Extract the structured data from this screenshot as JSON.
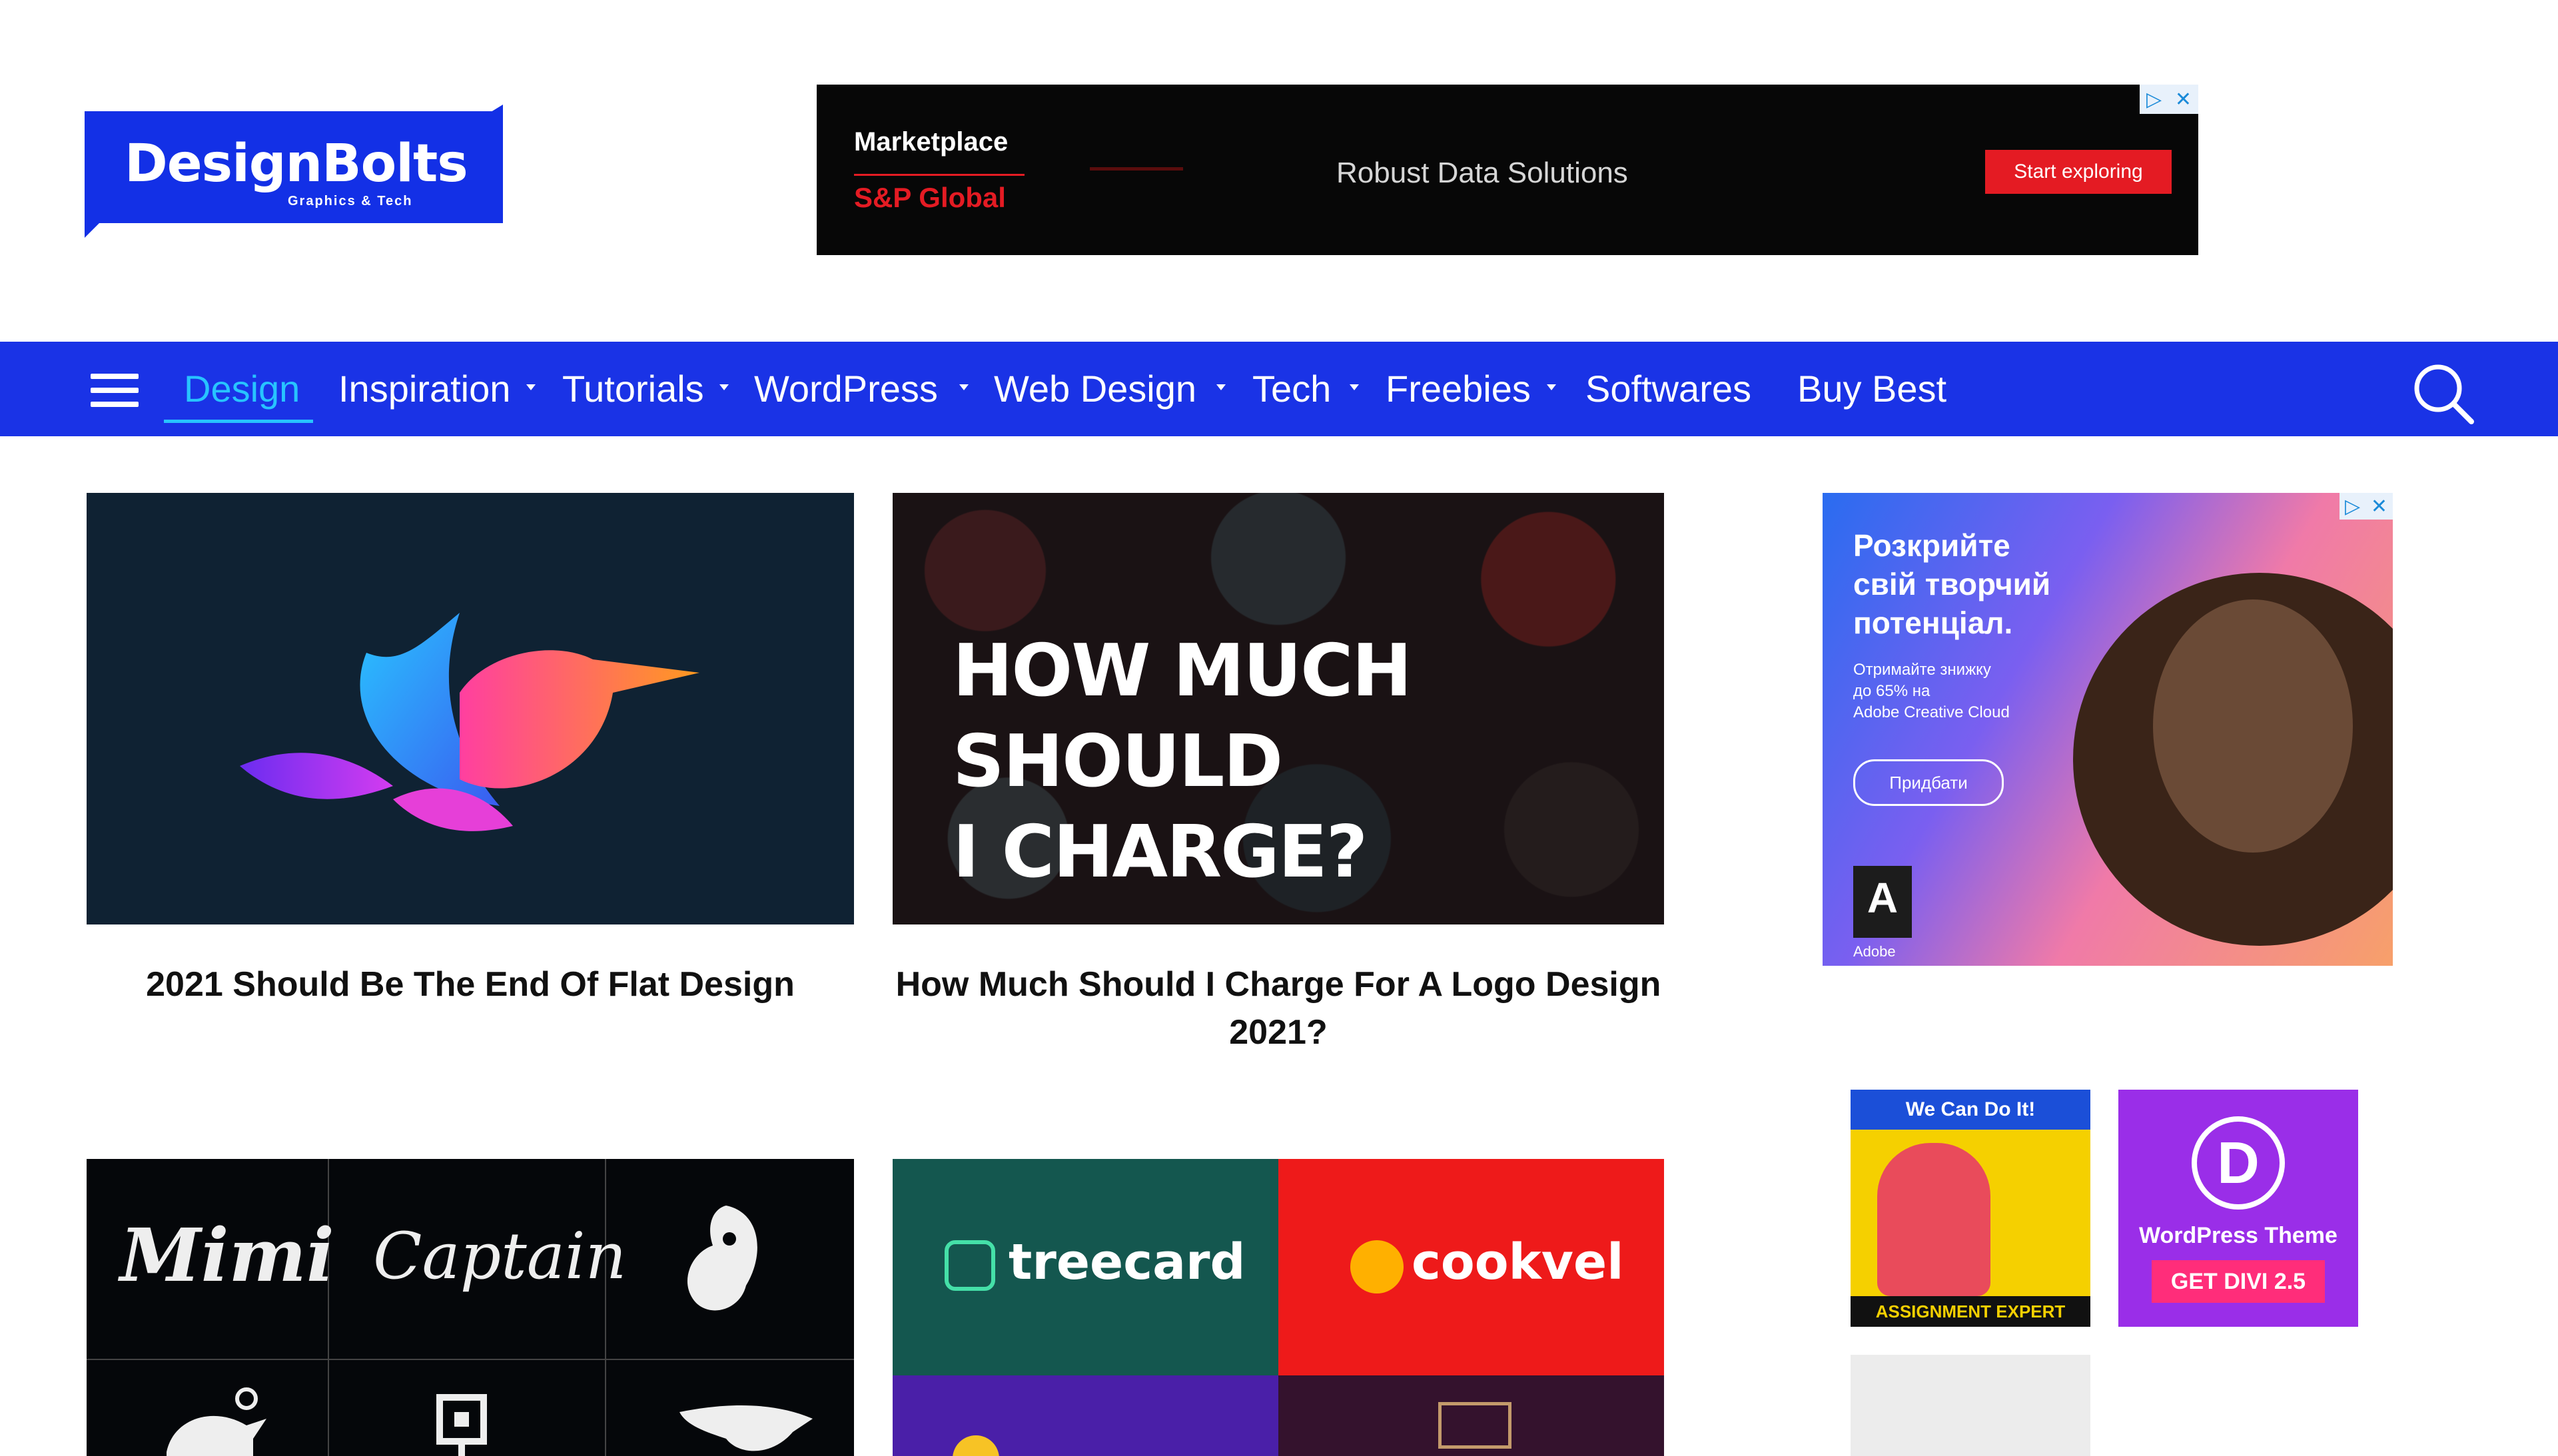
{
  "logo": {
    "text": "DesignBolts",
    "subtext": "Graphics & Tech"
  },
  "top_ad": {
    "brand_line1": "Marketplace",
    "brand_line2": "S&P Global",
    "tagline": "Robust Data Solutions",
    "cta": "Start exploring"
  },
  "nav": {
    "items": [
      {
        "label": "Design",
        "has_dropdown": false,
        "active": true
      },
      {
        "label": "Inspiration",
        "has_dropdown": true
      },
      {
        "label": "Tutorials",
        "has_dropdown": true
      },
      {
        "label": "WordPress",
        "has_dropdown": true
      },
      {
        "label": "Web Design",
        "has_dropdown": true
      },
      {
        "label": "Tech",
        "has_dropdown": true
      },
      {
        "label": "Freebies",
        "has_dropdown": true
      },
      {
        "label": "Softwares",
        "has_dropdown": false
      },
      {
        "label": "Buy Best",
        "has_dropdown": false
      }
    ]
  },
  "articles": [
    {
      "title": "2021 Should Be The End Of Flat Design"
    },
    {
      "title": "How Much Should I Charge For A Logo Design 2021?",
      "image_text_line1": "HOW MUCH SHOULD",
      "image_text_line2": "I CHARGE?"
    }
  ],
  "logos_grid": {
    "sig1": "Mimi",
    "sig2": "Captain"
  },
  "brands_grid": {
    "brand1": "treecard",
    "brand2": "cookvel"
  },
  "side_ad": {
    "headline": [
      "Розкрийте",
      "свій творчий",
      "потенціал."
    ],
    "subtext": [
      "Отримайте знижку",
      "до 65% на",
      "Adobe Creative Cloud"
    ],
    "button": "Придбати",
    "logo": "Adobe"
  },
  "small_ads": {
    "ad1_top": "We Can Do It!",
    "ad1_bottom": "ASSIGNMENT EXPERT",
    "ad2_line1": "WordPress Theme",
    "ad2_cta": "GET DIVI 2.5"
  },
  "colors": {
    "nav_bg": "#1a33e6",
    "active_nav": "#27c4ff"
  }
}
